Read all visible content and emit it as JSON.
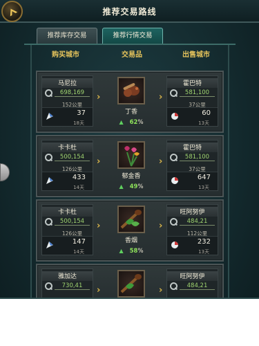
{
  "header": {
    "title": "推荐交易路线"
  },
  "tabs": [
    {
      "label": "推荐库存交易",
      "active": false
    },
    {
      "label": "推荐行情交易",
      "active": true
    }
  ],
  "columns": {
    "buy": "购买城市",
    "goods": "交易品",
    "sell": "出售城市"
  },
  "routes": [
    {
      "buy": {
        "city": "马尼拉",
        "price": "698,169",
        "distance": "152公里",
        "qty": "37",
        "days": "18天"
      },
      "goods": {
        "name": "丁香",
        "pct": "62",
        "pct_sign": "%",
        "icon": "clove-icon"
      },
      "sell": {
        "city": "霍巴特",
        "price": "581,100",
        "distance": "37公里",
        "qty": "60",
        "days": "13天"
      }
    },
    {
      "buy": {
        "city": "卡卡杜",
        "price": "500,154",
        "distance": "126公里",
        "qty": "433",
        "days": "14天"
      },
      "goods": {
        "name": "郁金香",
        "pct": "49",
        "pct_sign": "%",
        "icon": "tulip-icon"
      },
      "sell": {
        "city": "霍巴特",
        "price": "581,100",
        "distance": "37公里",
        "qty": "647",
        "days": "13天"
      }
    },
    {
      "buy": {
        "city": "卡卡杜",
        "price": "500,154",
        "distance": "126公里",
        "qty": "147",
        "days": "14天"
      },
      "goods": {
        "name": "香烟",
        "pct": "58",
        "pct_sign": "%",
        "icon": "tobacco-icon"
      },
      "sell": {
        "city": "旺阿努伊",
        "price": "484,21",
        "distance": "112公里",
        "qty": "232",
        "days": "13天"
      }
    },
    {
      "buy": {
        "city": "雅加达",
        "price": "730,41",
        "distance": "",
        "qty": "",
        "days": ""
      },
      "goods": {
        "name": "",
        "pct": "",
        "pct_sign": "",
        "icon": "tobacco-icon"
      },
      "sell": {
        "city": "旺阿努伊",
        "price": "484,21",
        "distance": "",
        "qty": "",
        "days": ""
      }
    }
  ],
  "colors": {
    "accent_gold": "#e6c45c",
    "price_green": "#9fd46f",
    "pct_green": "#8ee25a",
    "up_green": "#5fd05f"
  }
}
